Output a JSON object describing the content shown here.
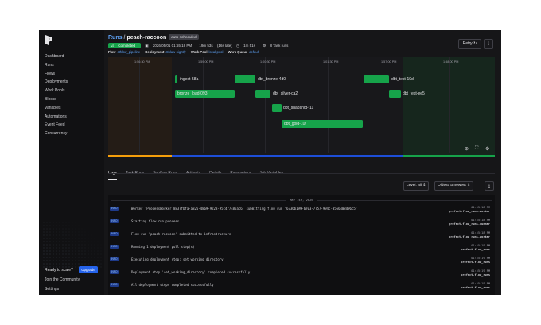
{
  "sidebar": {
    "items": [
      {
        "label": "Dashboard"
      },
      {
        "label": "Runs"
      },
      {
        "label": "Flows"
      },
      {
        "label": "Deployments"
      },
      {
        "label": "Work Pools"
      },
      {
        "label": "Blocks"
      },
      {
        "label": "Variables"
      },
      {
        "label": "Automations"
      },
      {
        "label": "Event Feed"
      },
      {
        "label": "Concurrency"
      }
    ],
    "ready_text": "Ready to scale?",
    "upgrade_label": "Upgrade",
    "community_label": "Join the Community",
    "settings_label": "Settings"
  },
  "header": {
    "runs_link": "Runs",
    "separator": "/",
    "run_name": "peach-raccoon",
    "tag": "auto-scheduled",
    "status": "Completed",
    "datetime": "2026/05/01 01:55:18 PM",
    "duration": "19m 53s",
    "extra_time": "(16s late)",
    "duration_short": "1m 51s",
    "task_runs": "8 Task runs",
    "flow_key": "Flow",
    "flow_val": "cthlaw_pipeline",
    "deployment_key": "Deployment",
    "deployment_val": "cthlaw-nightly",
    "work_pool_key": "Work Pool",
    "work_pool_val": "local-pool",
    "work_queue_key": "Work Queue",
    "work_queue_val": "default",
    "retry_label": "Retry",
    "more_icon": "⋮"
  },
  "timeline": {
    "ticks": [
      "1:56:30 PM",
      "1:59:00 PM",
      "1:00:30 PM",
      "1:01:30 PM",
      "1:57:00 PM",
      "1:58:00 PM"
    ],
    "tasks": [
      {
        "label": "ingest-58a"
      },
      {
        "label": "dbt_bronze-4d0"
      },
      {
        "label": "dbt_test-19d"
      },
      {
        "label": "bronze_load-093"
      },
      {
        "label": "dbt_silver-ca2"
      },
      {
        "label": "dbt_test-ee5"
      },
      {
        "label": "dbt_snapshot-f11"
      },
      {
        "label": "dbt_gold-10f"
      }
    ],
    "zoom_in_icon": "⊕",
    "fullscreen_icon": "⛶",
    "settings_icon": "⚙"
  },
  "tabs": [
    "Logs",
    "Task Runs",
    "Subflow Runs",
    "Artifacts",
    "Details",
    "Parameters",
    "Job Variables"
  ],
  "logs": {
    "level_filter": "Level: all",
    "sort": "Oldest to newest",
    "download_icon": "⤓",
    "date_divider": "May 1st, 2026",
    "entries": [
      {
        "level": "INFO",
        "message": "Worker 'ProcessWorker 8837fbfa-a826-4869-9228-95c477485ac6' submitting flow run '6736b199-6703-7757-994c-0566408d96c5'",
        "time": "01:55:18 PM",
        "source": "prefect.flow_runs.worker"
      },
      {
        "level": "INFO",
        "message": "Starting flow run process...",
        "time": "01:55:18 PM",
        "source": "prefect.flow_runs.runner"
      },
      {
        "level": "INFO",
        "message": "Flow run 'peach-raccoon' submitted to infrastructure",
        "time": "01:55:18 PM",
        "source": "prefect.flow_runs.worker"
      },
      {
        "level": "INFO",
        "message": "Running 1 deployment pull step(s)",
        "time": "01:55:19 PM",
        "source": "prefect.flow_runs"
      },
      {
        "level": "INFO",
        "message": "Executing deployment step: set_working_directory",
        "time": "01:55:19 PM",
        "source": "prefect.flow_runs"
      },
      {
        "level": "INFO",
        "message": "Deployment step 'set_working_directory' completed successfully",
        "time": "01:55:19 PM",
        "source": "prefect.flow_runs"
      },
      {
        "level": "INFO",
        "message": "All deployment steps completed successfully",
        "time": "01:55:19 PM",
        "source": "prefect.flow_runs"
      }
    ]
  },
  "colors": {
    "accent": "#60a5fa",
    "success": "#16a34a",
    "upgrade": "#2563eb"
  }
}
